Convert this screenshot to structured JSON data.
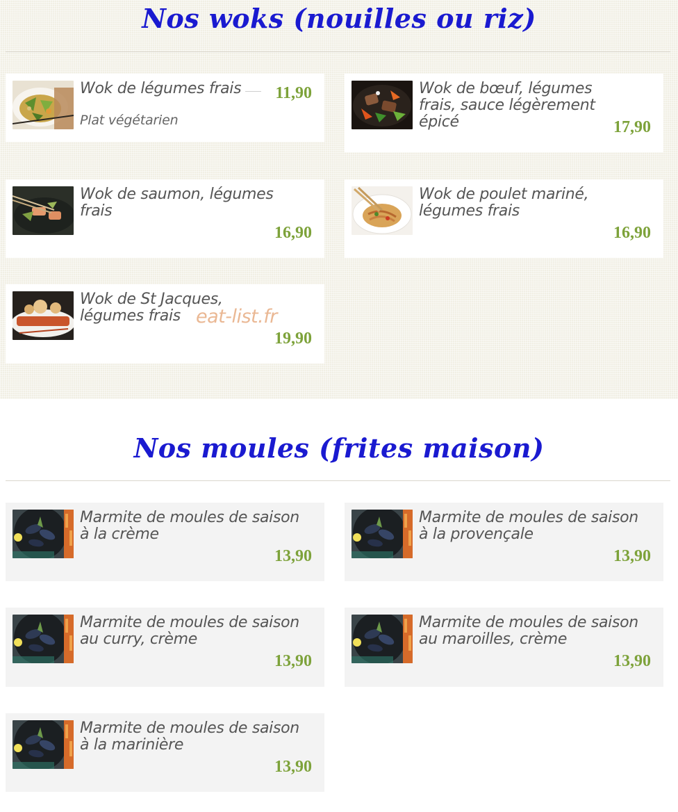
{
  "woks": {
    "title": "Nos woks (nouilles ou riz)",
    "items": [
      {
        "name": "Wok de légumes frais",
        "description": "Plat végétarien",
        "price": "11,90",
        "image_icon": "veggie-wok-photo-icon"
      },
      {
        "name": "Wok de bœuf, légumes frais, sauce légèrement épicé",
        "price": "17,90",
        "image_icon": "beef-wok-photo-icon"
      },
      {
        "name": "Wok de saumon, légumes frais",
        "price": "16,90",
        "image_icon": "salmon-wok-photo-icon"
      },
      {
        "name": "Wok de poulet mariné, légumes frais",
        "price": "16,90",
        "image_icon": "chicken-noodles-photo-icon"
      },
      {
        "name": "Wok de St Jacques, légumes frais",
        "price": "19,90",
        "image_icon": "scallops-photo-icon"
      }
    ]
  },
  "moules": {
    "title": "Nos moules (frites maison)",
    "items": [
      {
        "name": "Marmite de moules de saison à la crème",
        "price": "13,90",
        "image_icon": "mussels-pot-photo-icon"
      },
      {
        "name": "Marmite de moules de saison à la provençale",
        "price": "13,90",
        "image_icon": "mussels-pot-photo-icon"
      },
      {
        "name": "Marmite de moules de saison au curry, crème",
        "price": "13,90",
        "image_icon": "mussels-pot-photo-icon"
      },
      {
        "name": "Marmite de moules de saison au maroilles, crème",
        "price": "13,90",
        "image_icon": "mussels-pot-photo-icon"
      },
      {
        "name": "Marmite de moules de saison à la marinière",
        "price": "13,90",
        "image_icon": "mussels-pot-photo-icon"
      }
    ]
  },
  "watermark": "eat-list.fr",
  "colors": {
    "title": "#1a1ad0",
    "price": "#7da23a",
    "item_text": "#555555",
    "woks_background": "#f1efe4",
    "moules_card": "#f3f3f3",
    "watermark": "#eab894"
  }
}
